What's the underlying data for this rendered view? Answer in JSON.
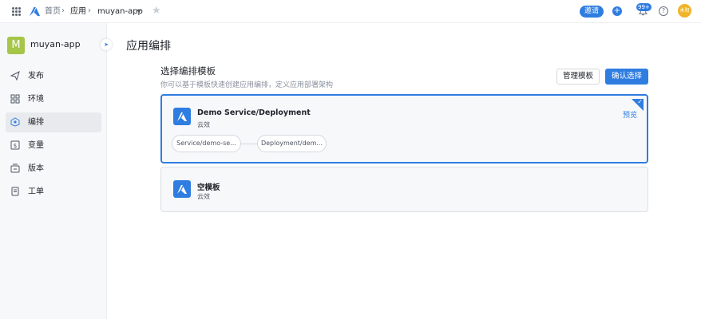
{
  "topbar": {
    "breadcrumb_home": "首页",
    "breadcrumb_apps": "应用",
    "breadcrumb_app": "muyan-app",
    "invite_label": "邀请",
    "plus_label": "+",
    "notification_count": "99+",
    "help_label": "?",
    "user_avatar": "木阳"
  },
  "sidebar": {
    "app_initial": "M",
    "app_name": "muyan-app",
    "collapse_glyph": "➤",
    "items": [
      {
        "label": "发布",
        "icon": "send-icon"
      },
      {
        "label": "环境",
        "icon": "grid-icon"
      },
      {
        "label": "编排",
        "icon": "orchestration-icon"
      },
      {
        "label": "变量",
        "icon": "dollar-icon"
      },
      {
        "label": "版本",
        "icon": "version-icon"
      },
      {
        "label": "工单",
        "icon": "ticket-icon"
      }
    ],
    "active_index": 2
  },
  "main": {
    "page_title": "应用编排",
    "section_title": "选择编排模板",
    "section_desc": "你可以基于模板快速创建应用编排，定义应用部署架构",
    "manage_button": "管理模板",
    "confirm_button": "确认选择",
    "templates": [
      {
        "name": "Demo Service/Deployment",
        "provider": "云效",
        "preview": "预览",
        "selected": true,
        "resources": [
          "Service/demo-se...",
          "Deployment/dem..."
        ]
      },
      {
        "name": "空模板",
        "provider": "云效",
        "selected": false
      }
    ]
  },
  "colors": {
    "accent": "#2f7de1",
    "app_avatar": "#a6c64a",
    "user_avatar": "#f0b429"
  }
}
